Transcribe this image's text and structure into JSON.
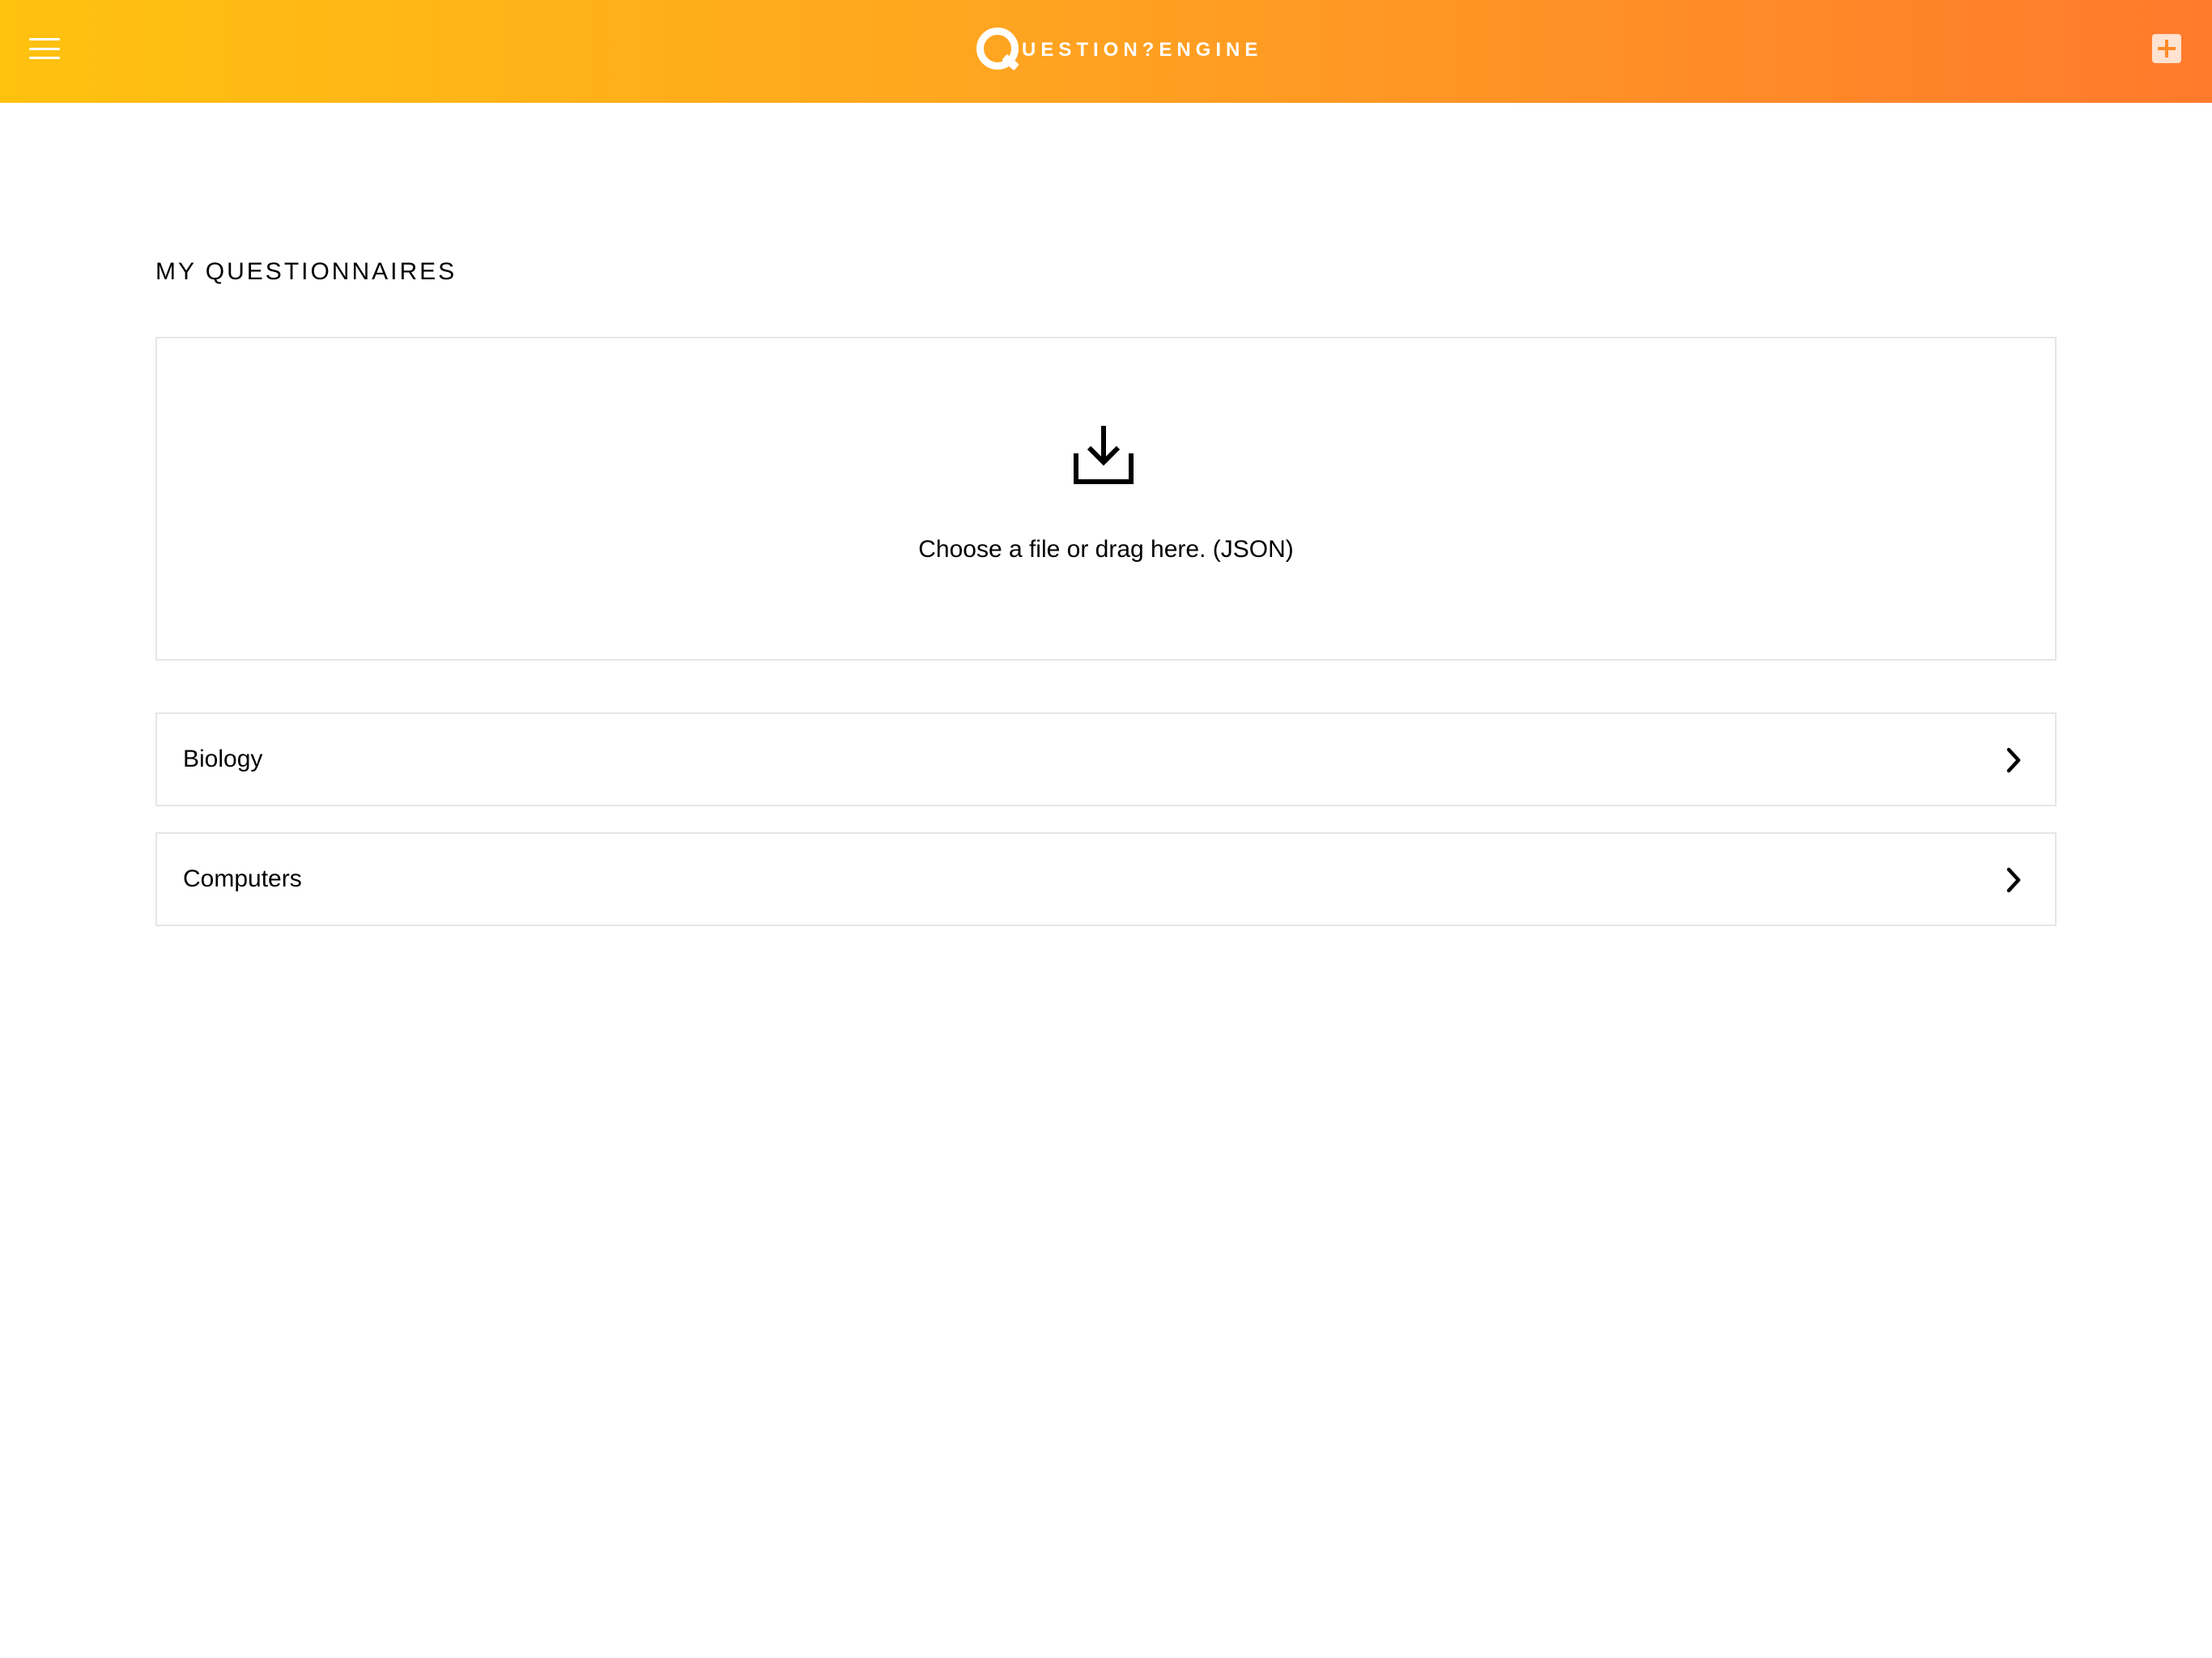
{
  "header": {
    "menu_icon": "hamburger-menu-icon",
    "logo_text": "UESTION?ENGINE",
    "add_icon": "plus-square-icon",
    "gradient_start": "#ffc20f",
    "gradient_end": "#ff7a2c"
  },
  "main": {
    "title": "MY QUESTIONNAIRES",
    "dropzone": {
      "icon": "download-tray-icon",
      "text": "Choose a file or drag here. (JSON)"
    },
    "questionnaires": [
      {
        "label": "Biology",
        "icon": "chevron-right-icon"
      },
      {
        "label": "Computers",
        "icon": "chevron-right-icon"
      }
    ]
  }
}
